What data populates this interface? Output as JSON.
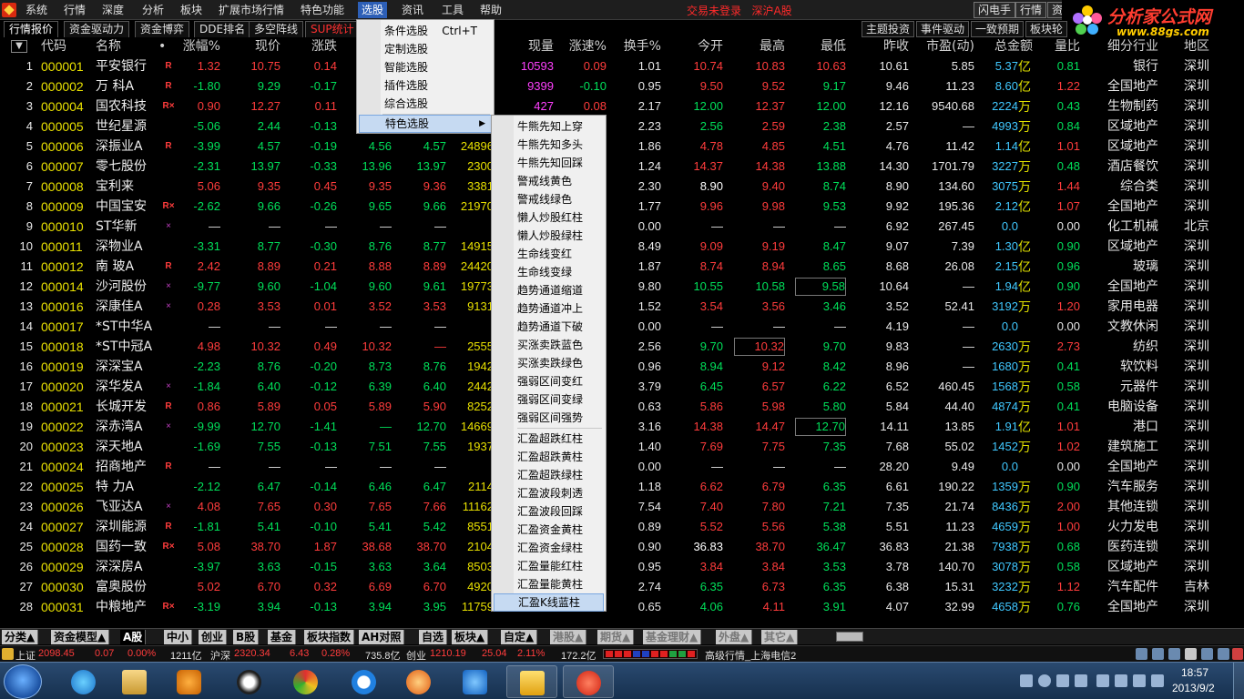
{
  "menubar": {
    "items": [
      "系统",
      "行情",
      "深度",
      "分析",
      "板块",
      "扩展市场行情",
      "特色功能",
      "选股",
      "资讯",
      "工具",
      "帮助"
    ],
    "login_status": "交易未登录",
    "market": "深沪A股",
    "right_buttons": [
      "闪电手",
      "行情",
      "资"
    ]
  },
  "brand": {
    "title": "分析家公式网",
    "url": "www.88gs.com"
  },
  "tabs": {
    "left": [
      "行情报价",
      "资金驱动力",
      "资金博弈",
      "DDE排名",
      "多空阵线",
      "SUP统计"
    ],
    "right": [
      "主题投资",
      "事件驱动",
      "一致预期",
      "板块轮"
    ]
  },
  "table": {
    "headers": [
      "代码",
      "名称",
      "•",
      "涨幅%",
      "现价",
      "涨跌",
      "买价",
      "卖价",
      "总量",
      "现量",
      "涨速%",
      "换手%",
      "今开",
      "最高",
      "最低",
      "昨收",
      "市盈(动)",
      "总金额",
      "量比",
      "细分行业",
      "地区"
    ],
    "rows": [
      {
        "n": "1",
        "code": "000001",
        "name": "平安银行",
        "flag": "R",
        "pct": "1.32",
        "price": "10.75",
        "chg": "0.14",
        "bid": "",
        "ask": "",
        "vol": "1",
        "cur": "10593",
        "spd": "0.09",
        "turn": "1.01",
        "open": "10.74",
        "high": "10.83",
        "low": "10.63",
        "prev": "10.61",
        "pe": "5.85",
        "amt": "5.37",
        "unit": "亿",
        "vr": "0.81",
        "ind": "银行",
        "reg": "深圳"
      },
      {
        "n": "2",
        "code": "000002",
        "name": "万 科A",
        "flag": "R",
        "pct": "-1.80",
        "price": "9.29",
        "chg": "-0.17",
        "bid": "",
        "ask": "",
        "vol": "9",
        "cur": "9399",
        "spd": "-0.10",
        "turn": "0.95",
        "open": "9.50",
        "high": "9.52",
        "low": "9.17",
        "prev": "9.46",
        "pe": "11.23",
        "amt": "8.60",
        "unit": "亿",
        "vr": "1.22",
        "ind": "全国地产",
        "reg": "深圳"
      },
      {
        "n": "3",
        "code": "000004",
        "name": "国农科技",
        "flag": "R×",
        "pct": "0.90",
        "price": "12.27",
        "chg": "0.11",
        "bid": "",
        "ask": "",
        "vol": "3",
        "cur": "427",
        "spd": "0.08",
        "turn": "2.17",
        "open": "12.00",
        "high": "12.37",
        "low": "12.00",
        "prev": "12.16",
        "pe": "9540.68",
        "amt": "2224",
        "unit": "万",
        "vr": "0.43",
        "ind": "生物制药",
        "reg": "深圳"
      },
      {
        "n": "4",
        "code": "000005",
        "name": "世纪星源",
        "flag": "",
        "pct": "-5.06",
        "price": "2.44",
        "chg": "-0.13",
        "bid": "",
        "ask": "",
        "vol": "",
        "cur": "",
        "spd": "",
        "turn": "2.23",
        "open": "2.56",
        "high": "2.59",
        "low": "2.38",
        "prev": "2.57",
        "pe": "—",
        "amt": "4993",
        "unit": "万",
        "vr": "0.84",
        "ind": "区域地产",
        "reg": "深圳"
      },
      {
        "n": "5",
        "code": "000006",
        "name": "深振业A",
        "flag": "R",
        "pct": "-3.99",
        "price": "4.57",
        "chg": "-0.19",
        "bid": "4.56",
        "ask": "4.57",
        "vol": "24896",
        "cur": "",
        "spd": "",
        "turn": "1.86",
        "open": "4.78",
        "high": "4.85",
        "low": "4.51",
        "prev": "4.76",
        "pe": "11.42",
        "amt": "1.14",
        "unit": "亿",
        "vr": "1.01",
        "ind": "区域地产",
        "reg": "深圳"
      },
      {
        "n": "6",
        "code": "000007",
        "name": "零七股份",
        "flag": "",
        "pct": "-2.31",
        "price": "13.97",
        "chg": "-0.33",
        "bid": "13.96",
        "ask": "13.97",
        "vol": "2300",
        "cur": "",
        "spd": "",
        "turn": "1.24",
        "open": "14.37",
        "high": "14.38",
        "low": "13.88",
        "prev": "14.30",
        "pe": "1701.79",
        "amt": "3227",
        "unit": "万",
        "vr": "0.48",
        "ind": "酒店餐饮",
        "reg": "深圳"
      },
      {
        "n": "7",
        "code": "000008",
        "name": "宝利来",
        "flag": "",
        "pct": "5.06",
        "price": "9.35",
        "chg": "0.45",
        "bid": "9.35",
        "ask": "9.36",
        "vol": "3381",
        "cur": "",
        "spd": "",
        "turn": "2.30",
        "open": "8.90",
        "high": "9.40",
        "low": "8.74",
        "prev": "8.90",
        "pe": "134.60",
        "amt": "3075",
        "unit": "万",
        "vr": "1.44",
        "ind": "综合类",
        "reg": "深圳"
      },
      {
        "n": "8",
        "code": "000009",
        "name": "中国宝安",
        "flag": "R×",
        "pct": "-2.62",
        "price": "9.66",
        "chg": "-0.26",
        "bid": "9.65",
        "ask": "9.66",
        "vol": "21970",
        "cur": "",
        "spd": "",
        "turn": "1.77",
        "open": "9.96",
        "high": "9.98",
        "low": "9.53",
        "prev": "9.92",
        "pe": "195.36",
        "amt": "2.12",
        "unit": "亿",
        "vr": "1.07",
        "ind": "全国地产",
        "reg": "深圳"
      },
      {
        "n": "9",
        "code": "000010",
        "name": "ST华新",
        "flag": "×",
        "pct": "—",
        "price": "—",
        "chg": "—",
        "bid": "—",
        "ask": "—",
        "vol": "",
        "cur": "",
        "spd": "",
        "turn": "0.00",
        "open": "—",
        "high": "—",
        "low": "—",
        "prev": "6.92",
        "pe": "267.45",
        "amt": "0.0",
        "unit": "",
        "vr": "0.00",
        "ind": "化工机械",
        "reg": "北京"
      },
      {
        "n": "10",
        "code": "000011",
        "name": "深物业A",
        "flag": "",
        "pct": "-3.31",
        "price": "8.77",
        "chg": "-0.30",
        "bid": "8.76",
        "ask": "8.77",
        "vol": "14915",
        "cur": "",
        "spd": "",
        "turn": "8.49",
        "open": "9.09",
        "high": "9.19",
        "low": "8.47",
        "prev": "9.07",
        "pe": "7.39",
        "amt": "1.30",
        "unit": "亿",
        "vr": "0.90",
        "ind": "区域地产",
        "reg": "深圳"
      },
      {
        "n": "11",
        "code": "000012",
        "name": "南 玻A",
        "flag": "R",
        "pct": "2.42",
        "price": "8.89",
        "chg": "0.21",
        "bid": "8.88",
        "ask": "8.89",
        "vol": "24420",
        "cur": "",
        "spd": "",
        "turn": "1.87",
        "open": "8.74",
        "high": "8.94",
        "low": "8.65",
        "prev": "8.68",
        "pe": "26.08",
        "amt": "2.15",
        "unit": "亿",
        "vr": "0.96",
        "ind": "玻璃",
        "reg": "深圳"
      },
      {
        "n": "12",
        "code": "000014",
        "name": "沙河股份",
        "flag": "×",
        "pct": "-9.77",
        "price": "9.60",
        "chg": "-1.04",
        "bid": "9.60",
        "ask": "9.61",
        "vol": "19773",
        "cur": "",
        "spd": "",
        "turn": "9.80",
        "open": "10.55",
        "high": "10.58",
        "low": "9.58",
        "prev": "10.64",
        "pe": "—",
        "amt": "1.94",
        "unit": "亿",
        "vr": "0.90",
        "ind": "全国地产",
        "reg": "深圳"
      },
      {
        "n": "13",
        "code": "000016",
        "name": "深康佳A",
        "flag": "×",
        "pct": "0.28",
        "price": "3.53",
        "chg": "0.01",
        "bid": "3.52",
        "ask": "3.53",
        "vol": "9131",
        "cur": "",
        "spd": "",
        "turn": "1.52",
        "open": "3.54",
        "high": "3.56",
        "low": "3.46",
        "prev": "3.52",
        "pe": "52.41",
        "amt": "3192",
        "unit": "万",
        "vr": "1.20",
        "ind": "家用电器",
        "reg": "深圳"
      },
      {
        "n": "14",
        "code": "000017",
        "name": "*ST中华A",
        "flag": "",
        "pct": "—",
        "price": "—",
        "chg": "—",
        "bid": "—",
        "ask": "—",
        "vol": "",
        "cur": "",
        "spd": "",
        "turn": "0.00",
        "open": "—",
        "high": "—",
        "low": "—",
        "prev": "4.19",
        "pe": "—",
        "amt": "0.0",
        "unit": "",
        "vr": "0.00",
        "ind": "文教休闲",
        "reg": "深圳"
      },
      {
        "n": "15",
        "code": "000018",
        "name": "*ST中冠A",
        "flag": "",
        "pct": "4.98",
        "price": "10.32",
        "chg": "0.49",
        "bid": "10.32",
        "ask": "—",
        "vol": "2555",
        "cur": "",
        "spd": "",
        "turn": "2.56",
        "open": "9.70",
        "high": "10.32",
        "low": "9.70",
        "prev": "9.83",
        "pe": "—",
        "amt": "2630",
        "unit": "万",
        "vr": "2.73",
        "ind": "纺织",
        "reg": "深圳"
      },
      {
        "n": "16",
        "code": "000019",
        "name": "深深宝A",
        "flag": "",
        "pct": "-2.23",
        "price": "8.76",
        "chg": "-0.20",
        "bid": "8.73",
        "ask": "8.76",
        "vol": "1942",
        "cur": "",
        "spd": "",
        "turn": "0.96",
        "open": "8.94",
        "high": "9.12",
        "low": "8.42",
        "prev": "8.96",
        "pe": "—",
        "amt": "1680",
        "unit": "万",
        "vr": "0.41",
        "ind": "软饮料",
        "reg": "深圳"
      },
      {
        "n": "17",
        "code": "000020",
        "name": "深华发A",
        "flag": "×",
        "pct": "-1.84",
        "price": "6.40",
        "chg": "-0.12",
        "bid": "6.39",
        "ask": "6.40",
        "vol": "2442",
        "cur": "",
        "spd": "",
        "turn": "3.79",
        "open": "6.45",
        "high": "6.57",
        "low": "6.22",
        "prev": "6.52",
        "pe": "460.45",
        "amt": "1568",
        "unit": "万",
        "vr": "0.58",
        "ind": "元器件",
        "reg": "深圳"
      },
      {
        "n": "18",
        "code": "000021",
        "name": "长城开发",
        "flag": "R",
        "pct": "0.86",
        "price": "5.89",
        "chg": "0.05",
        "bid": "5.89",
        "ask": "5.90",
        "vol": "8252",
        "cur": "",
        "spd": "",
        "turn": "0.63",
        "open": "5.86",
        "high": "5.98",
        "low": "5.80",
        "prev": "5.84",
        "pe": "44.40",
        "amt": "4874",
        "unit": "万",
        "vr": "0.41",
        "ind": "电脑设备",
        "reg": "深圳"
      },
      {
        "n": "19",
        "code": "000022",
        "name": "深赤湾A",
        "flag": "×",
        "pct": "-9.99",
        "price": "12.70",
        "chg": "-1.41",
        "bid": "—",
        "ask": "12.70",
        "vol": "14669",
        "cur": "",
        "spd": "",
        "turn": "3.16",
        "open": "14.38",
        "high": "14.47",
        "low": "12.70",
        "prev": "14.11",
        "pe": "13.85",
        "amt": "1.91",
        "unit": "亿",
        "vr": "1.01",
        "ind": "港口",
        "reg": "深圳"
      },
      {
        "n": "20",
        "code": "000023",
        "name": "深天地A",
        "flag": "",
        "pct": "-1.69",
        "price": "7.55",
        "chg": "-0.13",
        "bid": "7.51",
        "ask": "7.55",
        "vol": "1937",
        "cur": "",
        "spd": "",
        "turn": "1.40",
        "open": "7.69",
        "high": "7.75",
        "low": "7.35",
        "prev": "7.68",
        "pe": "55.02",
        "amt": "1452",
        "unit": "万",
        "vr": "1.02",
        "ind": "建筑施工",
        "reg": "深圳"
      },
      {
        "n": "21",
        "code": "000024",
        "name": "招商地产",
        "flag": "R",
        "pct": "—",
        "price": "—",
        "chg": "—",
        "bid": "—",
        "ask": "—",
        "vol": "",
        "cur": "",
        "spd": "",
        "turn": "0.00",
        "open": "—",
        "high": "—",
        "low": "—",
        "prev": "28.20",
        "pe": "9.49",
        "amt": "0.0",
        "unit": "",
        "vr": "0.00",
        "ind": "全国地产",
        "reg": "深圳"
      },
      {
        "n": "22",
        "code": "000025",
        "name": "特 力A",
        "flag": "",
        "pct": "-2.12",
        "price": "6.47",
        "chg": "-0.14",
        "bid": "6.46",
        "ask": "6.47",
        "vol": "2114",
        "cur": "",
        "spd": "",
        "turn": "1.18",
        "open": "6.62",
        "high": "6.79",
        "low": "6.35",
        "prev": "6.61",
        "pe": "190.22",
        "amt": "1359",
        "unit": "万",
        "vr": "0.90",
        "ind": "汽车服务",
        "reg": "深圳"
      },
      {
        "n": "23",
        "code": "000026",
        "name": "飞亚达A",
        "flag": "×",
        "pct": "4.08",
        "price": "7.65",
        "chg": "0.30",
        "bid": "7.65",
        "ask": "7.66",
        "vol": "11162",
        "cur": "",
        "spd": "",
        "turn": "7.54",
        "open": "7.40",
        "high": "7.80",
        "low": "7.21",
        "prev": "7.35",
        "pe": "21.74",
        "amt": "8436",
        "unit": "万",
        "vr": "2.00",
        "ind": "其他连锁",
        "reg": "深圳"
      },
      {
        "n": "24",
        "code": "000027",
        "name": "深圳能源",
        "flag": "R",
        "pct": "-1.81",
        "price": "5.41",
        "chg": "-0.10",
        "bid": "5.41",
        "ask": "5.42",
        "vol": "8551",
        "cur": "",
        "spd": "",
        "turn": "0.89",
        "open": "5.52",
        "high": "5.56",
        "low": "5.38",
        "prev": "5.51",
        "pe": "11.23",
        "amt": "4659",
        "unit": "万",
        "vr": "1.00",
        "ind": "火力发电",
        "reg": "深圳"
      },
      {
        "n": "25",
        "code": "000028",
        "name": "国药一致",
        "flag": "R×",
        "pct": "5.08",
        "price": "38.70",
        "chg": "1.87",
        "bid": "38.68",
        "ask": "38.70",
        "vol": "2104",
        "cur": "",
        "spd": "",
        "turn": "0.90",
        "open": "36.83",
        "high": "38.70",
        "low": "36.47",
        "prev": "36.83",
        "pe": "21.38",
        "amt": "7938",
        "unit": "万",
        "vr": "0.68",
        "ind": "医药连锁",
        "reg": "深圳"
      },
      {
        "n": "26",
        "code": "000029",
        "name": "深深房A",
        "flag": "",
        "pct": "-3.97",
        "price": "3.63",
        "chg": "-0.15",
        "bid": "3.63",
        "ask": "3.64",
        "vol": "8503",
        "cur": "",
        "spd": "",
        "turn": "0.95",
        "open": "3.84",
        "high": "3.84",
        "low": "3.53",
        "prev": "3.78",
        "pe": "140.70",
        "amt": "3078",
        "unit": "万",
        "vr": "0.58",
        "ind": "区域地产",
        "reg": "深圳"
      },
      {
        "n": "27",
        "code": "000030",
        "name": "富奥股份",
        "flag": "",
        "pct": "5.02",
        "price": "6.70",
        "chg": "0.32",
        "bid": "6.69",
        "ask": "6.70",
        "vol": "4920",
        "cur": "",
        "spd": "",
        "turn": "2.74",
        "open": "6.35",
        "high": "6.73",
        "low": "6.35",
        "prev": "6.38",
        "pe": "15.31",
        "amt": "3232",
        "unit": "万",
        "vr": "1.12",
        "ind": "汽车配件",
        "reg": "吉林"
      },
      {
        "n": "28",
        "code": "000031",
        "name": "中粮地产",
        "flag": "R×",
        "pct": "-3.19",
        "price": "3.94",
        "chg": "-0.13",
        "bid": "3.94",
        "ask": "3.95",
        "vol": "11759",
        "cur": "",
        "spd": "",
        "turn": "0.65",
        "open": "4.06",
        "high": "4.11",
        "low": "3.91",
        "prev": "4.07",
        "pe": "32.99",
        "amt": "4658",
        "unit": "万",
        "vr": "0.76",
        "ind": "全国地产",
        "reg": "深圳"
      }
    ]
  },
  "menu_xuangu": {
    "items": [
      {
        "label": "条件选股",
        "shortcut": "Ctrl+T"
      },
      {
        "label": "定制选股",
        "shortcut": ""
      },
      {
        "label": "智能选股",
        "shortcut": ""
      },
      {
        "label": "插件选股",
        "shortcut": ""
      },
      {
        "label": "综合选股",
        "shortcut": ""
      },
      {
        "label": "特色选股",
        "shortcut": ""
      }
    ]
  },
  "menu_tese": {
    "items": [
      "牛熊先知上穿",
      "牛熊先知多头",
      "牛熊先知回踩",
      "警戒线黄色",
      "警戒线绿色",
      "懒人炒股红柱",
      "懒人炒股绿柱",
      "生命线变红",
      "生命线变绿",
      "趋势通道缩道",
      "趋势通道冲上",
      "趋势通道下破",
      "买涨卖跌蓝色",
      "买涨卖跌绿色",
      "强弱区间变红",
      "强弱区间变绿",
      "强弱区间强势",
      "汇盈超跌红柱",
      "汇盈超跌黄柱",
      "汇盈超跌绿柱",
      "汇盈波段刺透",
      "汇盈波段回踩",
      "汇盈资金黄柱",
      "汇盈资金绿柱",
      "汇盈量能红柱",
      "汇盈量能黄柱",
      "汇盈K线蓝柱"
    ]
  },
  "category_tabs": [
    "分类▲",
    "资金模型▲",
    "A股",
    "中小",
    "创业",
    "B股",
    "基金",
    "板块指数",
    "AH对照",
    "自选",
    "板块▲",
    "自定▲",
    "港股▲",
    "期货▲",
    "基金理财▲",
    "外盘▲",
    "其它▲"
  ],
  "statusbar": {
    "sh_label": "上证",
    "sh_index": "2098.45",
    "sh_chg": "0.07",
    "sh_pct": "0.00%",
    "sh_amt": "1211亿",
    "sz_label": "沪深",
    "sz_index": "2320.34",
    "sz_chg": "6.43",
    "sz_pct": "0.28%",
    "sz_amt": "735.8亿",
    "cy_label": "创业",
    "cy_index": "1210.19",
    "cy_chg": "25.04",
    "cy_pct": "2.11%",
    "cy_amt": "172.2亿",
    "feed": "高级行情_上海电信2"
  },
  "taskbar": {
    "time": "18:57",
    "date": "2013/9/2"
  },
  "colors": {
    "up": "#ff3c3c",
    "down": "#00e05a",
    "menu_highlight": "#2d5fb6",
    "amount": "#40c8ff"
  }
}
